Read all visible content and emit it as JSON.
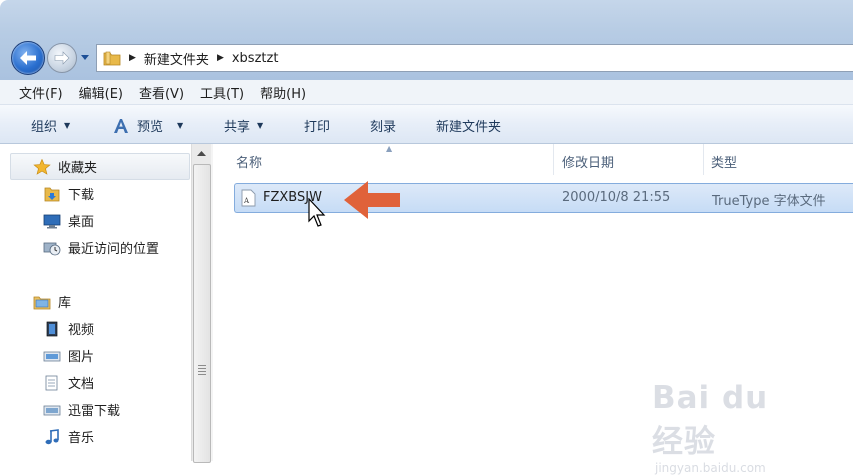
{
  "breadcrumb": [
    "新建文件夹",
    "xbsztzt"
  ],
  "menu": [
    "文件(F)",
    "编辑(E)",
    "查看(V)",
    "工具(T)",
    "帮助(H)"
  ],
  "toolbar": {
    "organize": "组织",
    "preview": "预览",
    "share": "共享",
    "print": "打印",
    "burn": "刻录",
    "new_folder": "新建文件夹"
  },
  "navigation": {
    "favorites": {
      "label": "收藏夹",
      "items": [
        {
          "label": "下载",
          "icon": "download-folder-icon"
        },
        {
          "label": "桌面",
          "icon": "desktop-icon"
        },
        {
          "label": "最近访问的位置",
          "icon": "recent-places-icon"
        }
      ]
    },
    "libraries": {
      "label": "库",
      "items": [
        {
          "label": "视频",
          "icon": "video-library-icon"
        },
        {
          "label": "图片",
          "icon": "pictures-library-icon"
        },
        {
          "label": "文档",
          "icon": "documents-library-icon"
        },
        {
          "label": "迅雷下载",
          "icon": "thunder-download-library-icon"
        },
        {
          "label": "音乐",
          "icon": "music-library-icon"
        }
      ]
    }
  },
  "columns": {
    "name": "名称",
    "modified": "修改日期",
    "type": "类型"
  },
  "files": [
    {
      "name": "FZXBSJW",
      "modified": "2000/10/8 21:55",
      "type": "TrueType 字体文件",
      "selected": true
    }
  ],
  "watermark": {
    "brand": "Bai du 经验",
    "url": "jingyan.baidu.com"
  },
  "colors": {
    "highlight_arrow": "#e0623a",
    "selection": "#c6dcf6",
    "title_bar": "#b7cce4"
  }
}
